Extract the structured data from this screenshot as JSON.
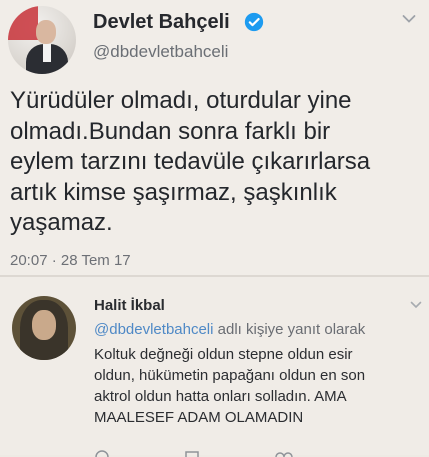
{
  "main_tweet": {
    "author_name": "Devlet Bahçeli",
    "handle": "@dbdevletbahceli",
    "text_lines": [
      "Yürüdüler olmadı, oturdular yine",
      "olmadı.Bundan sonra farklı bir",
      "eylem tarzını tedavüle çıkarırlarsa",
      "artık kimse şaşırmaz, şaşkınlık",
      "yaşamaz."
    ],
    "timestamp": "20:07 · 28 Tem 17",
    "icons": {
      "verified": "verified-badge-icon",
      "menu": "chevron-down-icon"
    }
  },
  "reply_tweet": {
    "author_name": "Halit İkbal",
    "reply_to_mention": "@dbdevletbahceli",
    "reply_to_suffix": " adlı kişiye yanıt olarak",
    "text_lines": [
      "Koltuk değneği oldun stepne oldun esir",
      "oldun, hükümetin papağanı oldun en son",
      "aktrol oldun hatta onları solladın. AMA",
      "MAALESEF ADAM OLAMADIN"
    ],
    "icons": {
      "menu": "chevron-down-icon"
    }
  },
  "colors": {
    "background": "#f1ede8",
    "verified_blue": "#1d9bf0",
    "mention_blue": "#4f89c6",
    "muted_text": "#6d7076"
  }
}
